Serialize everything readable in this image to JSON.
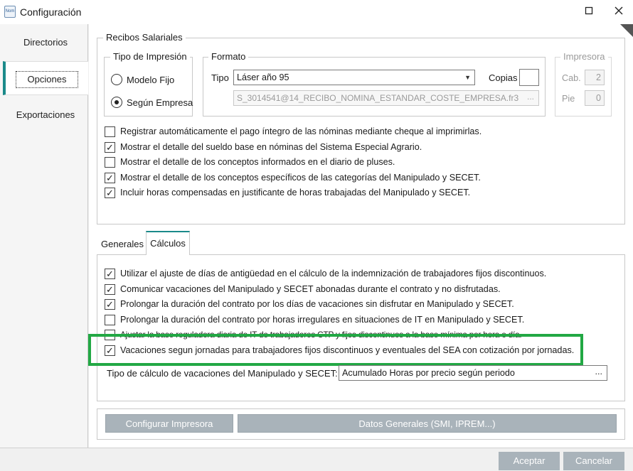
{
  "window": {
    "title": "Configuración",
    "icon_text": "Nom",
    "minimize_icon": "restore",
    "close_icon": "close"
  },
  "nav": {
    "items": [
      {
        "label": "Directorios"
      },
      {
        "label": "Opciones"
      },
      {
        "label": "Exportaciones"
      }
    ]
  },
  "recibos": {
    "legend": "Recibos Salariales",
    "tipo_impresion": {
      "legend": "Tipo de Impresión",
      "options": [
        {
          "label": "Modelo Fijo",
          "selected": false
        },
        {
          "label": "Según Empresa",
          "selected": true
        }
      ]
    },
    "formato": {
      "legend": "Formato",
      "tipo_label": "Tipo",
      "tipo_value": "Láser año 95",
      "copias_label": "Copias",
      "copias_value": "",
      "file_value": "S_3014541@14_RECIBO_NOMINA_ESTANDAR_COSTE_EMPRESA.fr3",
      "file_button": "..."
    },
    "impresora": {
      "legend": "Impresora",
      "cab_label": "Cab.",
      "cab_value": "2",
      "pie_label": "Pie",
      "pie_value": "0"
    },
    "checks": [
      {
        "label": "Registrar automáticamente el pago íntegro de las nóminas mediante cheque al imprimirlas.",
        "checked": false
      },
      {
        "label": "Mostrar el detalle del sueldo base en nóminas del Sistema Especial Agrario.",
        "checked": true
      },
      {
        "label": "Mostrar el detalle de los conceptos informados en el diario de pluses.",
        "checked": false
      },
      {
        "label": "Mostrar el detalle de los conceptos específicos de las categorías del Manipulado y SECET.",
        "checked": true
      },
      {
        "label": "Incluir horas compensadas en justificante de horas trabajadas del Manipulado y SECET.",
        "checked": true
      }
    ]
  },
  "tabs": {
    "items": [
      {
        "label": "Generales"
      },
      {
        "label": "Cálculos"
      }
    ],
    "active": 1
  },
  "calculos": {
    "checks": [
      {
        "label": "Utilizar el ajuste de días de antigüedad en el cálculo de la indemnización de trabajadores fijos discontinuos.",
        "checked": true
      },
      {
        "label": "Comunicar vacaciones del Manipulado y SECET abonadas durante el contrato y no disfrutadas.",
        "checked": true
      },
      {
        "label": "Prolongar la duración del contrato por los días de vacaciones sin disfrutar en Manipulado y SECET.",
        "checked": true
      },
      {
        "label": "Prolongar la duración del contrato por horas irregulares en situaciones de IT en Manipulado y SECET.",
        "checked": false
      },
      {
        "label": "Ajustar la base reguladora diaria de IT de trabajadores CTP y fijos discontinuos a la base mínima por hora o día.",
        "checked": false
      },
      {
        "label": "Vacaciones segun  jornadas para trabajadores fijos discontinuos y eventuales del SEA con cotización por jornadas.",
        "checked": true
      }
    ],
    "tipo_calculo_label": "Tipo de cálculo de vacaciones del Manipulado y SECET:",
    "tipo_calculo_value": "Acumulado Horas por precio según periodo",
    "tipo_calculo_button": "..."
  },
  "bottom_buttons": {
    "configurar": "Configurar Impresora",
    "datos": "Datos Generales (SMI, IPREM...)"
  },
  "footer": {
    "aceptar": "Aceptar",
    "cancelar": "Cancelar"
  },
  "colors": {
    "accent": "#1a8a8a",
    "highlight": "#22a844",
    "button": "#a9b3ba"
  }
}
